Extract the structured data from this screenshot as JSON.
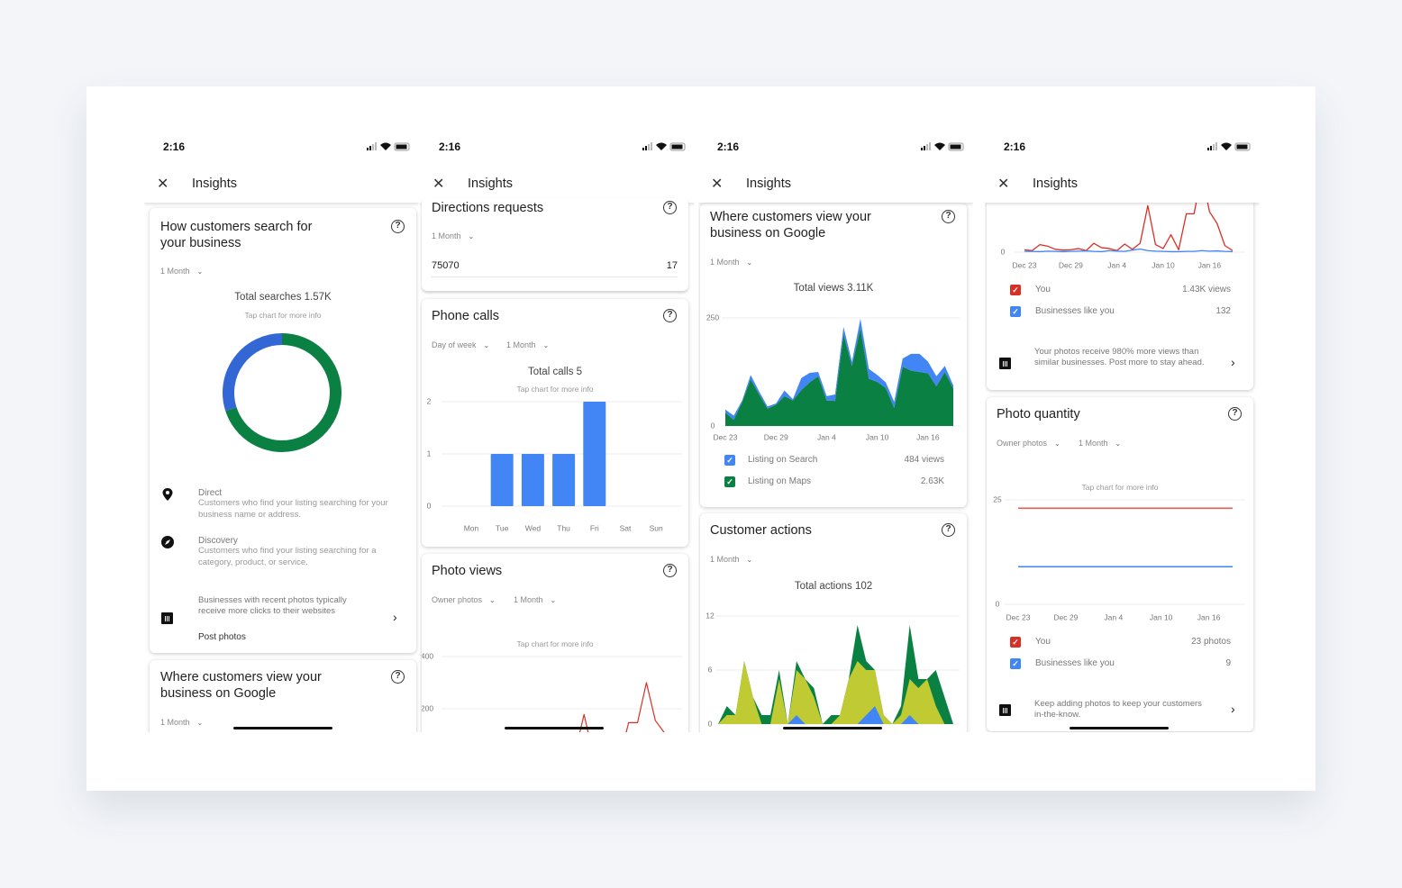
{
  "status": {
    "time": "2:16"
  },
  "header": {
    "title": "Insights",
    "close_icon": "close-icon"
  },
  "colors": {
    "blue": "#4285f4",
    "donut_blue": "#3367d6",
    "green": "#0b8043",
    "yellow_green": "#c0ca33",
    "red": "#d93025",
    "quantity_red": "#e06055"
  },
  "phone1": {
    "search_card": {
      "title": "How customers search for your business",
      "period": "1 Month",
      "total": "Total searches 1.57K",
      "hint": "Tap chart for more info",
      "legend": [
        {
          "label": "Direct",
          "desc": "Customers who find your listing searching for your business name or address.",
          "icon": "pin-icon"
        },
        {
          "label": "Discovery",
          "desc": "Customers who find your listing searching for a category, product, or service.",
          "icon": "compass-icon"
        }
      ],
      "tip": {
        "text": "Businesses with recent photos typically receive more clicks to their websites",
        "action": "Post photos"
      }
    },
    "views_card": {
      "title": "Where customers view your business on Google",
      "period": "1 Month"
    }
  },
  "phone2": {
    "directions": {
      "title": "Directions requests",
      "period": "1 Month",
      "rows": [
        {
          "label": "75070",
          "value": "17"
        }
      ]
    },
    "calls": {
      "title": "Phone calls",
      "filters": [
        "Day of week",
        "1 Month"
      ],
      "total": "Total calls 5",
      "hint": "Tap chart for more info"
    },
    "photo_views": {
      "title": "Photo views",
      "filters": [
        "Owner photos",
        "1 Month"
      ],
      "hint": "Tap chart for more info"
    }
  },
  "phone3": {
    "views": {
      "title": "Where customers view your business on Google",
      "period": "1 Month",
      "total": "Total views 3.11K",
      "legend": [
        {
          "label": "Listing on Search",
          "value": "484 views"
        },
        {
          "label": "Listing on Maps",
          "value": "2.63K"
        }
      ]
    },
    "actions": {
      "title": "Customer actions",
      "period": "1 Month",
      "total": "Total actions 102"
    }
  },
  "phone4": {
    "photo_views": {
      "legend": [
        {
          "label": "You",
          "value": "1.43K views"
        },
        {
          "label": "Businesses like you",
          "value": "132"
        }
      ],
      "tip": "Your photos receive 980% more views than similar businesses. Post more to stay ahead."
    },
    "quantity": {
      "title": "Photo quantity",
      "filters": [
        "Owner photos",
        "1 Month"
      ],
      "hint": "Tap chart for more info",
      "legend": [
        {
          "label": "You",
          "value": "23 photos"
        },
        {
          "label": "Businesses like you",
          "value": "9"
        }
      ],
      "tip": "Keep adding photos to keep your customers in-the-know."
    }
  },
  "chart_data": [
    {
      "id": "searches",
      "type": "pie",
      "donut": true,
      "segments": [
        {
          "color": "#3367d6",
          "fraction": 0.3
        },
        {
          "color": "#0b8043",
          "fraction": 0.7
        }
      ]
    },
    {
      "id": "calls",
      "type": "bar",
      "categories": [
        "Mon",
        "Tue",
        "Wed",
        "Thu",
        "Fri",
        "Sat",
        "Sun"
      ],
      "values": [
        0,
        1,
        1,
        1,
        2,
        0,
        0
      ],
      "ylim": [
        0,
        2
      ],
      "yticks": [
        "0",
        "1",
        "2"
      ],
      "grid": true,
      "color": "#4285f4"
    },
    {
      "id": "photo_views_p2",
      "type": "line",
      "ylim": [
        0,
        400
      ],
      "yticks": [
        "200",
        "400"
      ],
      "grid": true,
      "series": [
        {
          "color": "#d93025",
          "values": [
            9,
            6,
            29,
            23,
            11,
            8,
            9,
            14,
            6,
            34,
            17,
            14,
            6,
            31,
            11,
            34,
            178,
            29,
            14,
            67,
            9,
            147,
            147,
            300,
            155,
            109,
            25,
            6
          ]
        }
      ]
    },
    {
      "id": "views",
      "type": "area",
      "stacked": true,
      "ylim": [
        0,
        250
      ],
      "yticks": [
        "0",
        "250"
      ],
      "x_tick_labels": [
        "Dec 23",
        "Dec 29",
        "Jan 4",
        "Jan 10",
        "Jan 16"
      ],
      "grid": true,
      "series": [
        {
          "name": "Listing on Maps",
          "color": "#0b8043",
          "values": [
            31,
            14,
            56,
            108,
            73,
            40,
            49,
            69,
            59,
            83,
            101,
            115,
            59,
            58,
            212,
            139,
            226,
            109,
            102,
            88,
            42,
            137,
            128,
            125,
            122,
            92,
            125,
            87
          ]
        },
        {
          "name": "Listing on Search",
          "color": "#4285f4",
          "values": [
            7,
            10,
            3,
            10,
            7,
            5,
            3,
            13,
            3,
            28,
            22,
            10,
            10,
            15,
            17,
            10,
            22,
            23,
            16,
            13,
            14,
            19,
            39,
            42,
            27,
            23,
            14,
            7
          ]
        }
      ]
    },
    {
      "id": "actions",
      "type": "area",
      "stacked": true,
      "ylim": [
        0,
        12
      ],
      "yticks": [
        "0",
        "6",
        "12"
      ],
      "grid": true,
      "series": [
        {
          "color": "#4285f4",
          "values": [
            0,
            0,
            0,
            0,
            0,
            0,
            0,
            0,
            0,
            1,
            0,
            0,
            0,
            0,
            0,
            0,
            0,
            1,
            2,
            0,
            0,
            0,
            1,
            0,
            0,
            0,
            0,
            0
          ]
        },
        {
          "color": "#c0ca33",
          "values": [
            0,
            1,
            1,
            7,
            3,
            0,
            0,
            5,
            0,
            5,
            5,
            3,
            0,
            0,
            1,
            5,
            7,
            5,
            4,
            1,
            0,
            1,
            4,
            4,
            5,
            2,
            0,
            0
          ]
        },
        {
          "color": "#0b8043",
          "values": [
            0,
            1,
            0,
            0,
            0,
            1,
            1,
            1,
            0,
            1,
            0,
            1,
            0,
            1,
            0,
            0,
            4,
            1,
            0,
            0,
            0,
            1,
            6,
            1,
            0,
            4,
            3,
            0
          ]
        }
      ]
    },
    {
      "id": "photo_views_p4",
      "type": "line",
      "ylim": [
        0,
        400
      ],
      "yticks": [
        "0"
      ],
      "x_tick_labels": [
        "Dec 23",
        "Dec 29",
        "Jan 4",
        "Jan 10",
        "Jan 16"
      ],
      "grid": true,
      "series": [
        {
          "name": "You",
          "color": "#d93025",
          "values": [
            9,
            6,
            29,
            23,
            11,
            8,
            9,
            14,
            6,
            34,
            17,
            14,
            6,
            31,
            11,
            34,
            178,
            29,
            14,
            67,
            9,
            147,
            147,
            300,
            155,
            109,
            25,
            6
          ]
        },
        {
          "name": "Businesses like you",
          "color": "#4285f4",
          "values": [
            3,
            3,
            2,
            4,
            3,
            2,
            3,
            4,
            5,
            3,
            2,
            6,
            4,
            3,
            8,
            12,
            6,
            4,
            3,
            2,
            2,
            3,
            3,
            6,
            4,
            5,
            3,
            2
          ]
        }
      ]
    },
    {
      "id": "quantity",
      "type": "line",
      "ylim": [
        0,
        25
      ],
      "yticks": [
        "0",
        "25"
      ],
      "x_tick_labels": [
        "Dec 23",
        "Dec 29",
        "Jan 4",
        "Jan 10",
        "Jan 16"
      ],
      "grid": true,
      "series": [
        {
          "name": "You",
          "color": "#e06055",
          "values": [
            23,
            23,
            23,
            23,
            23,
            23,
            23,
            23,
            23,
            23,
            23,
            23,
            23,
            23,
            23,
            23,
            23,
            23,
            23,
            23,
            23,
            23,
            23,
            23,
            23,
            23,
            23,
            23
          ]
        },
        {
          "name": "Businesses like you",
          "color": "#4285f4",
          "values": [
            9,
            9,
            9,
            9,
            9,
            9,
            9,
            9,
            9,
            9,
            9,
            9,
            9,
            9,
            9,
            9,
            9,
            9,
            9,
            9,
            9,
            9,
            9,
            9,
            9,
            9,
            9,
            9
          ]
        }
      ]
    }
  ]
}
